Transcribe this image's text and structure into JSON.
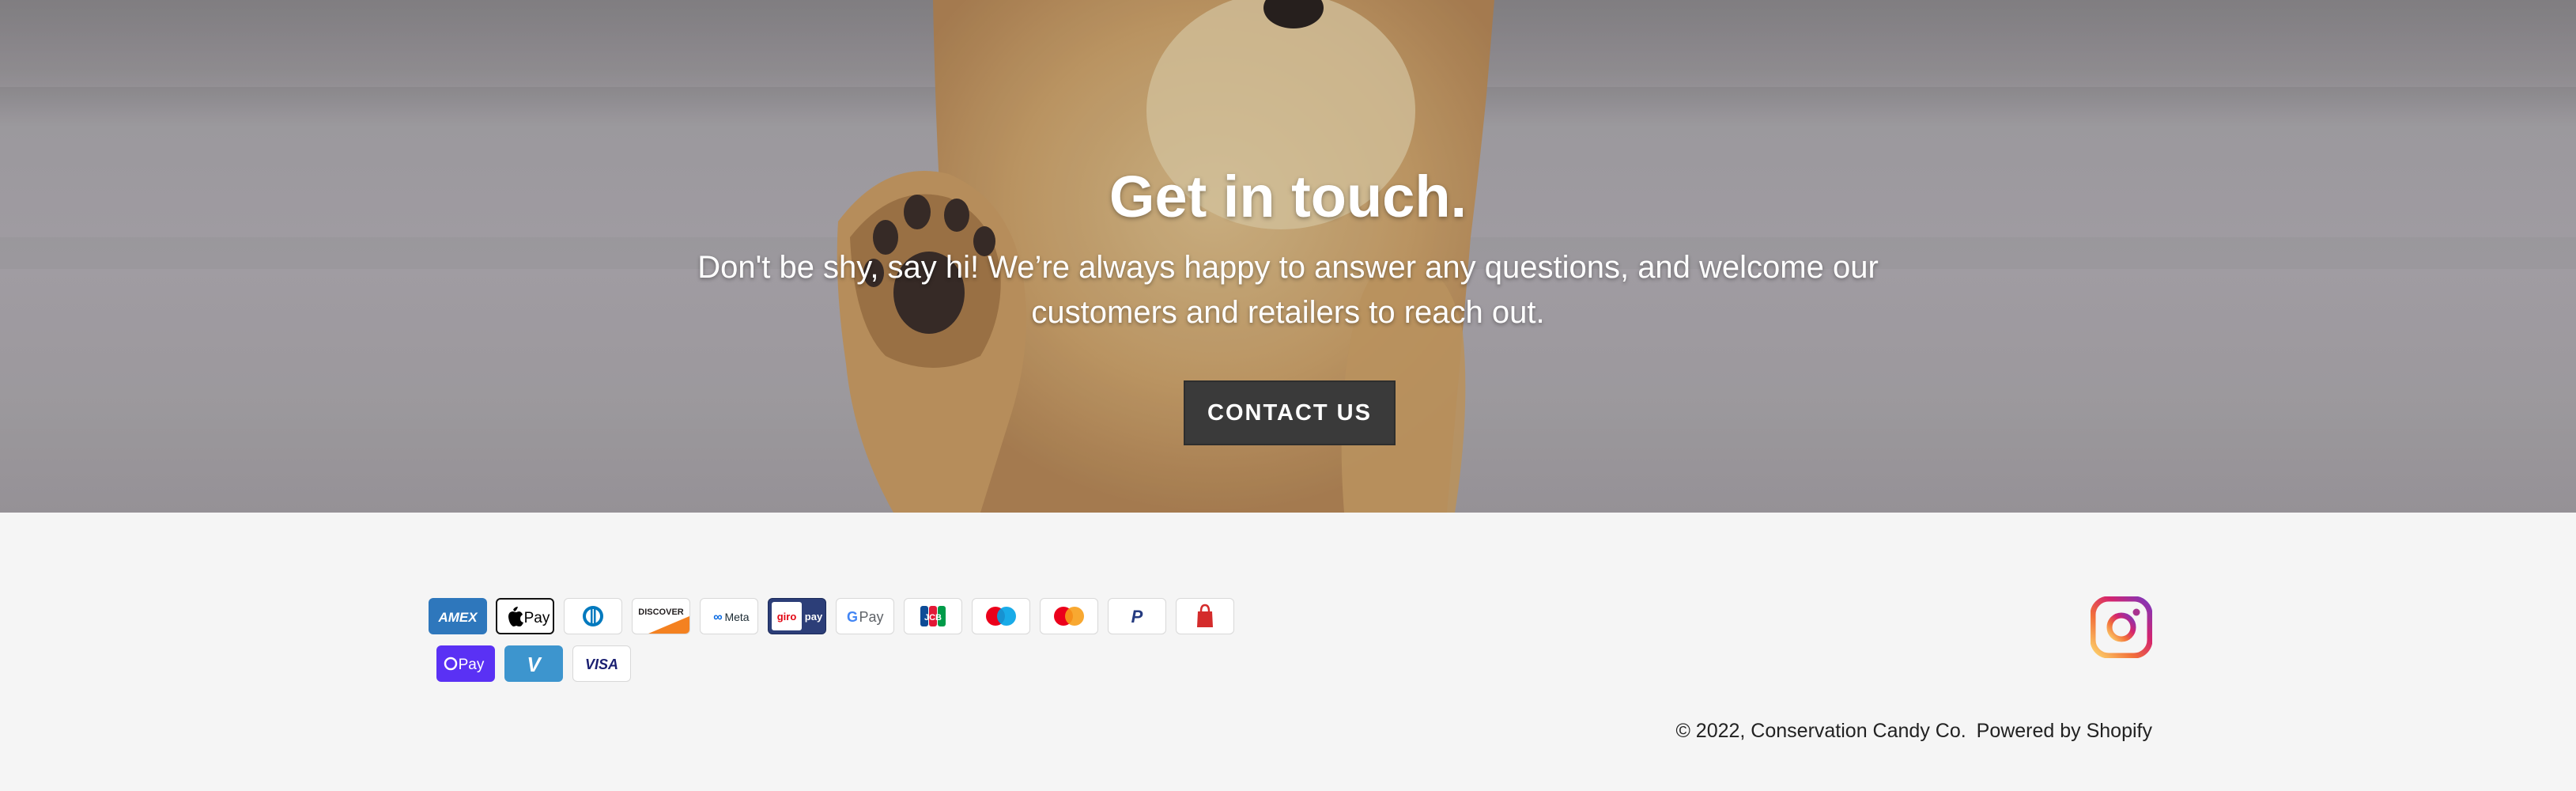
{
  "hero": {
    "title": "Get in touch.",
    "text": "Don't be shy, say hi! We’re always happy to answer any questions, and welcome our customers and retailers to reach out.",
    "button_label": "CONTACT US"
  },
  "payments": [
    {
      "name": "American Express",
      "label": "AMEX"
    },
    {
      "name": "Apple Pay",
      "label": "Pay"
    },
    {
      "name": "Diners Club",
      "label": ""
    },
    {
      "name": "Discover",
      "label": "DISCOVER"
    },
    {
      "name": "Meta Pay",
      "label": "Meta"
    },
    {
      "name": "Giropay",
      "label": "giro pay"
    },
    {
      "name": "Google Pay",
      "label": "G Pay"
    },
    {
      "name": "JCB",
      "label": "JCB"
    },
    {
      "name": "Maestro",
      "label": ""
    },
    {
      "name": "Mastercard",
      "label": ""
    },
    {
      "name": "PayPal",
      "label": "P"
    },
    {
      "name": "Shop Pay",
      "label": ""
    },
    {
      "name": "Shop Pay",
      "label": "Pay"
    },
    {
      "name": "Venmo",
      "label": "V"
    },
    {
      "name": "Visa",
      "label": "VISA"
    }
  ],
  "footer": {
    "copyright": "© 2022, Conservation Candy Co.",
    "powered_by": "Powered by Shopify",
    "social_icon": "instagram-icon"
  },
  "colors": {
    "button_bg": "#3a3a3a",
    "footer_bg": "#f5f5f5",
    "amex": "#2e77bc",
    "shop_pay": "#5a31f4",
    "venmo": "#3d95ce"
  }
}
